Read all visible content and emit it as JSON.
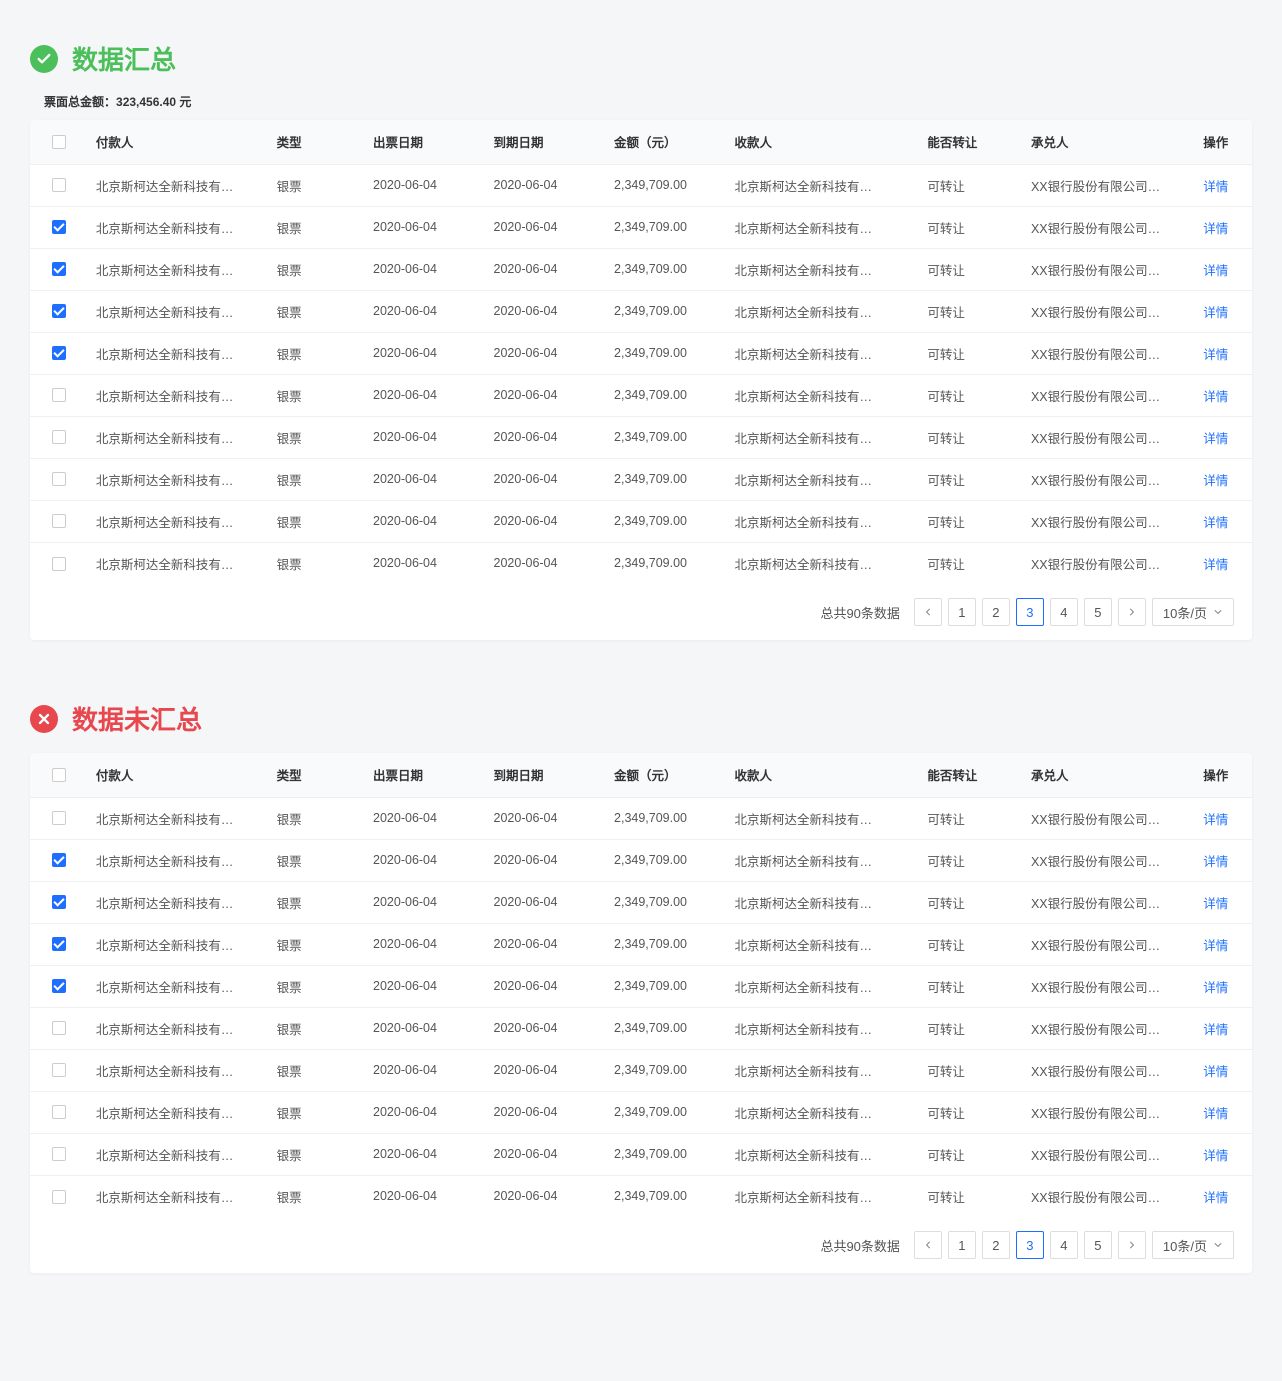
{
  "sections": [
    {
      "icon": "check",
      "color": "green",
      "title": "数据汇总",
      "summary": {
        "label": "票面总金额：",
        "value": "323,456.40",
        "unit": " 元"
      }
    },
    {
      "icon": "cross",
      "color": "red",
      "title": "数据未汇总",
      "summary": null
    }
  ],
  "columns": {
    "payer": "付款人",
    "type": "类型",
    "issue": "出票日期",
    "due": "到期日期",
    "amount": "金额（元）",
    "payee": "收款人",
    "transfer": "能否转让",
    "acceptor": "承兑人",
    "action": "操作"
  },
  "row_template": {
    "payer": "北京斯柯达全新科技有…",
    "type": "银票",
    "issue": "2020-06-04",
    "due": "2020-06-04",
    "amount": "2,349,709.00",
    "payee": "北京斯柯达全新科技有…",
    "transfer": "可转让",
    "acceptor": "XX银行股份有限公司…",
    "action": "详情"
  },
  "checked_rows": [
    false,
    true,
    true,
    true,
    true,
    false,
    false,
    false,
    false,
    false
  ],
  "pagination": {
    "total_text": "总共90条数据",
    "pages": [
      "1",
      "2",
      "3",
      "4",
      "5"
    ],
    "active": "3",
    "size": "10条/页"
  }
}
